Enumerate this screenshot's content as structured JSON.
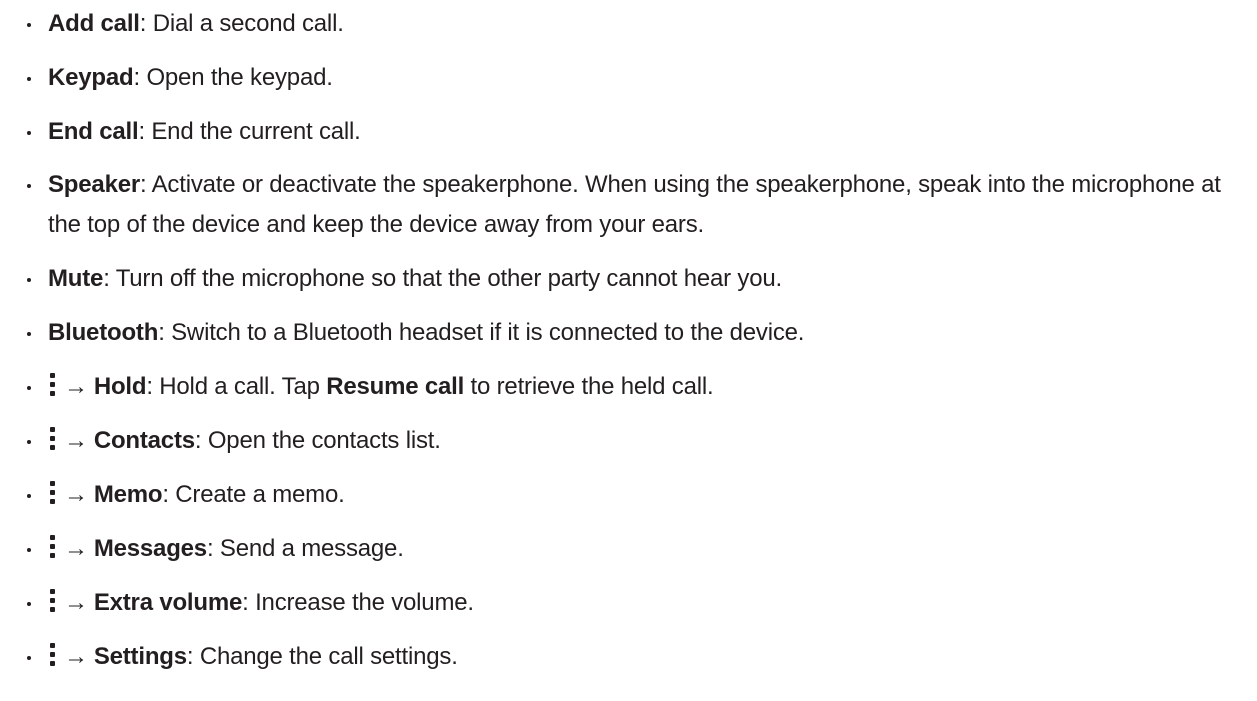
{
  "items": [
    {
      "menu": false,
      "term": "Add call",
      "sep": ": ",
      "desc": "Dial a second call."
    },
    {
      "menu": false,
      "term": "Keypad",
      "sep": ": ",
      "desc": "Open the keypad."
    },
    {
      "menu": false,
      "term": "End call",
      "sep": ": ",
      "desc": "End the current call."
    },
    {
      "menu": false,
      "term": "Speaker",
      "sep": ": ",
      "desc": "Activate or deactivate the speakerphone. When using the speakerphone, speak into the microphone at the top of the device and keep the device away from your ears."
    },
    {
      "menu": false,
      "term": "Mute",
      "sep": ": ",
      "desc": "Turn off the microphone so that the other party cannot hear you."
    },
    {
      "menu": false,
      "term": "Bluetooth",
      "sep": ": ",
      "desc": "Switch to a Bluetooth headset if it is connected to the device."
    },
    {
      "menu": true,
      "arrow": "→",
      "term": "Hold",
      "sep": ": ",
      "desc": "Hold a call. Tap ",
      "term2": "Resume call",
      "desc2": " to retrieve the held call."
    },
    {
      "menu": true,
      "arrow": "→",
      "term": "Contacts",
      "sep": ": ",
      "desc": "Open the contacts list."
    },
    {
      "menu": true,
      "arrow": "→",
      "term": "Memo",
      "sep": ": ",
      "desc": "Create a memo."
    },
    {
      "menu": true,
      "arrow": "→",
      "term": "Messages",
      "sep": ": ",
      "desc": "Send a message."
    },
    {
      "menu": true,
      "arrow": "→",
      "term": "Extra volume",
      "sep": ": ",
      "desc": "Increase the volume."
    },
    {
      "menu": true,
      "arrow": "→",
      "term": "Settings",
      "sep": ": ",
      "desc": "Change the call settings."
    }
  ],
  "icons": {
    "more": "more-options-icon"
  }
}
